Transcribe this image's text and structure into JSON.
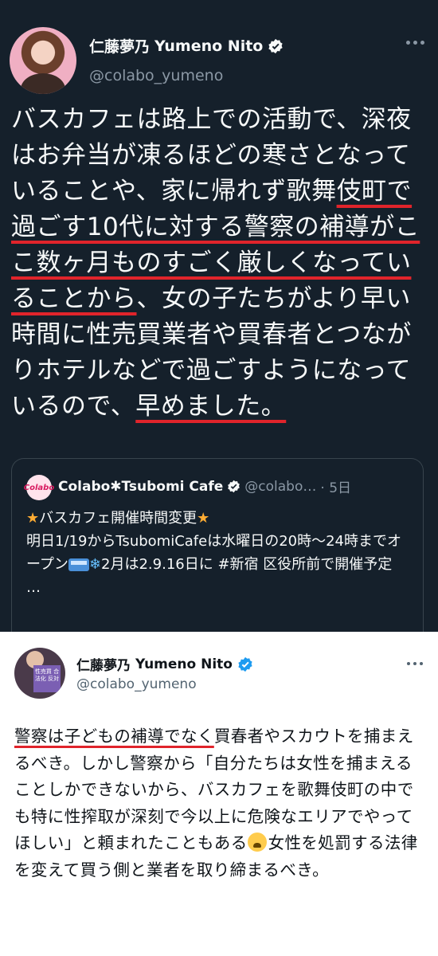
{
  "tweet1": {
    "display_name": "仁藤夢乃",
    "display_name_en": "Yumeno Nito",
    "handle": "@colabo_yumeno",
    "text_parts": [
      {
        "t": "バスカフェは路上での活動で、深夜はお弁当が凍るほどの寒さとなっていることや、家に帰れず歌舞",
        "ul": false
      },
      {
        "t": "伎町で過ごす10代に対する警察の補導がここ数ヶ月ものすごく厳しくなっていることから",
        "ul": true
      },
      {
        "t": "、女の子たちがより早い時間に性売買業者や買春者とつながりホテルなどで過ごすようになっているので、",
        "ul": false
      },
      {
        "t": "早めました。",
        "ul": true
      }
    ],
    "quote": {
      "avatar_text": "Colabo",
      "name": "Colabo✱Tsubomi Cafe",
      "handle": "@colabo…",
      "time": "· 5日",
      "lines": [
        "バスカフェ開催時間変更",
        "明日1/19からTsubomiCafeは水曜日の20時〜24時までオープン",
        "2月は2.9.16日に #新宿 区役所前で開催予定",
        "…"
      ]
    }
  },
  "tweet2": {
    "display_name": "仁藤夢乃",
    "display_name_en": "Yumeno Nito",
    "handle": "@colabo_yumeno",
    "avatar_sign": "性売買 合法化 反対",
    "text_underlined": "警察は子どもの補導でなく",
    "text_rest": "買春者やスカウトを捕まえるべき。しかし警察から「自分たちは女性を捕まえることしかできないから、バスカフェを歌舞伎町の中でも特に性搾取が深刻で今以上に危険なエリアでやってほしい」と頼まれたこともある",
    "text_end": "女性を処罰する法律を変えて買う側と業者を取り締まるべき。"
  },
  "colors": {
    "dark_bg": "#15202b",
    "light_bg": "#ffffff",
    "verified_blue": "#1d9bf0",
    "underline_red": "#e0242b"
  }
}
